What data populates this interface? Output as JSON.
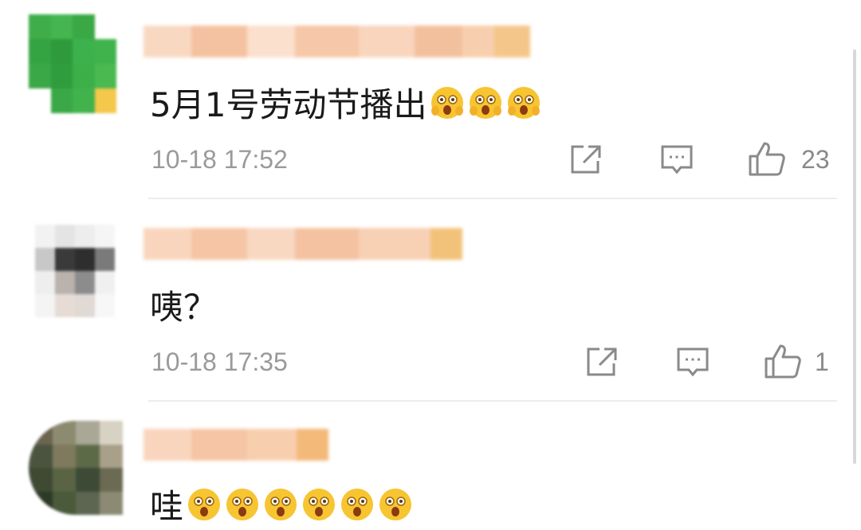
{
  "comments": [
    {
      "text": "5月1号劳动节播出",
      "emoji_count": 3,
      "time": "10-18 17:52",
      "likes": "23"
    },
    {
      "text": "咦？",
      "emoji_count": 0,
      "time": "10-18 17:35",
      "likes": "1"
    },
    {
      "text": "哇",
      "emoji_count": 6,
      "time": "",
      "likes": ""
    }
  ],
  "icons": {
    "share": "share-icon",
    "reply": "comment-icon",
    "like": "thumbs-up-icon",
    "emoji": "surprised-face-emoji"
  },
  "colors": {
    "text": "#1a1a1a",
    "meta": "#9a9a9a",
    "icon": "#8a8a8a",
    "divider": "#ececec",
    "name_blur": "#f6c7a8"
  }
}
